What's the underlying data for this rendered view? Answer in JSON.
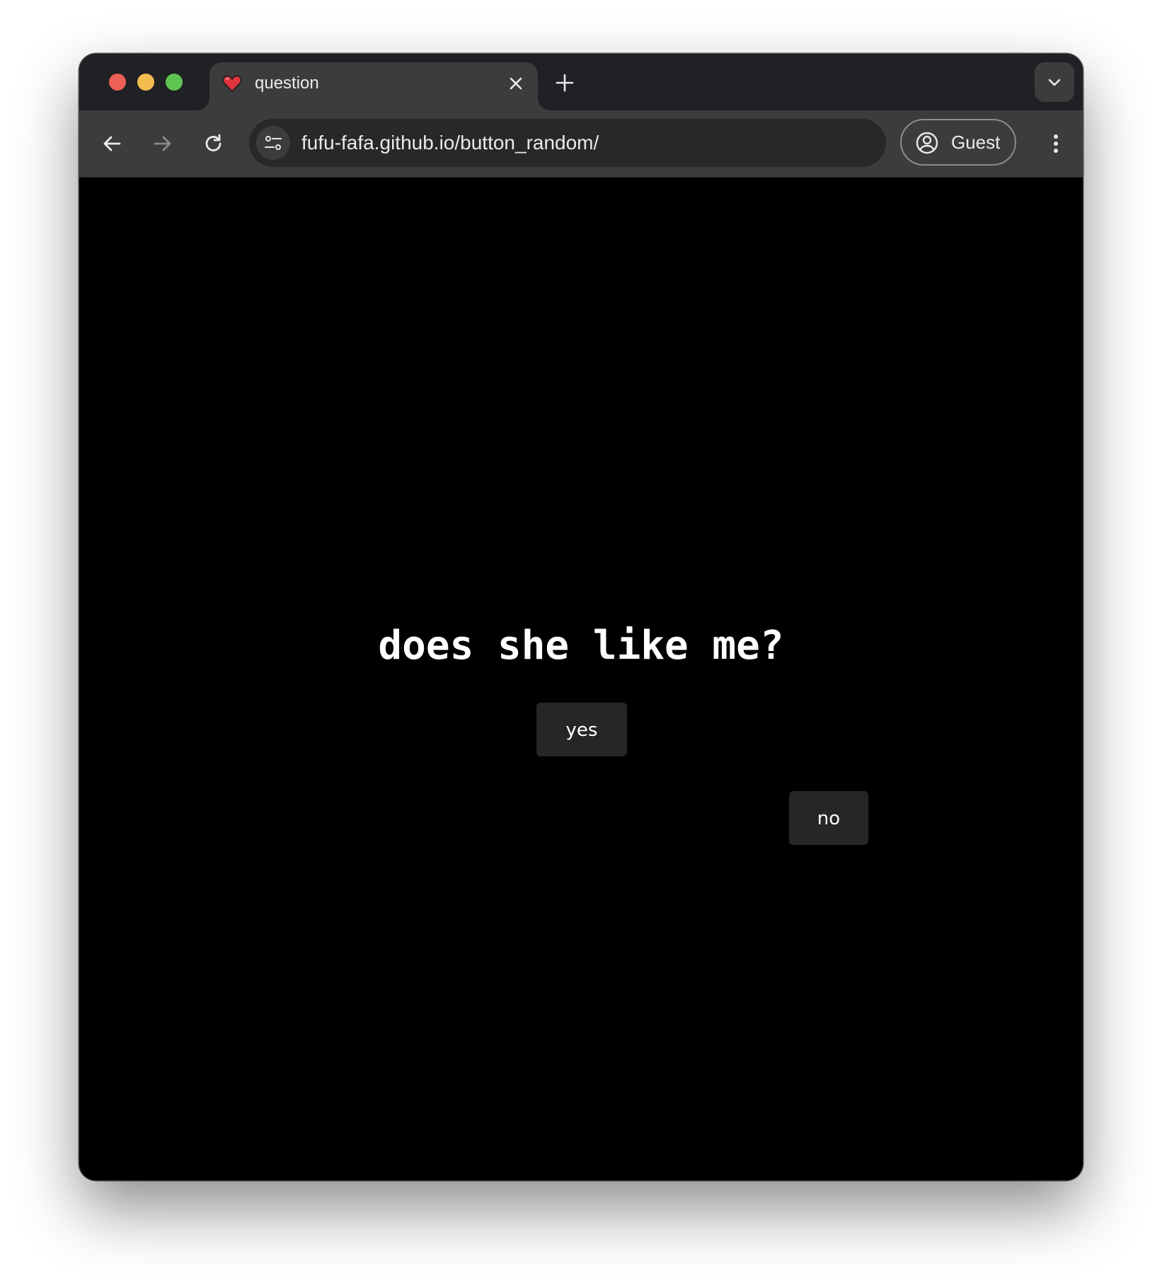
{
  "browser": {
    "tab": {
      "title": "question",
      "favicon": "heart-icon"
    },
    "address_bar": {
      "url": "fufu-fafa.github.io/button_random/"
    },
    "profile": {
      "label": "Guest"
    }
  },
  "page": {
    "question": "does she like me?",
    "yes_label": "yes",
    "no_label": "no"
  },
  "colors": {
    "page_background": "#000000",
    "button_background": "#262626",
    "text": "#ffffff",
    "favicon_heart": "#e0343f"
  }
}
